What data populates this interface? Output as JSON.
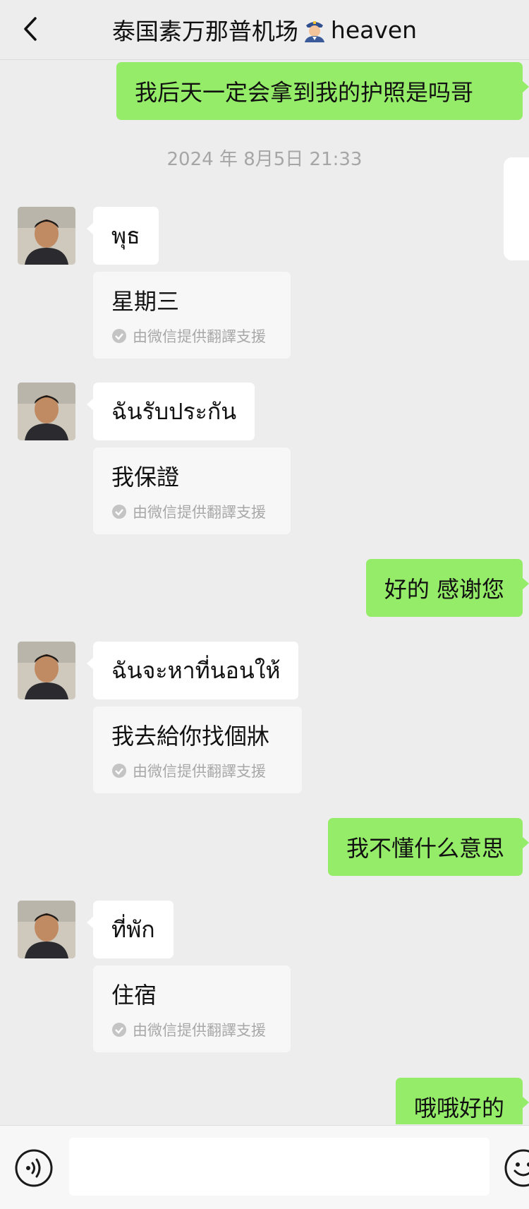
{
  "header": {
    "title": "泰国素万那普机场",
    "title_suffix": "heaven",
    "back_icon": "chevron-left-icon",
    "title_icon": "police-officer-emoji"
  },
  "timestamp": "2024 年 8月5日 21:33",
  "messages": {
    "out_1": "我后天一定会拿到我的护照是吗哥",
    "in_1": "พุธ",
    "in_1_translation": "星期三",
    "in_2": "ฉันรับประกัน",
    "in_2_translation": "我保證",
    "out_2": "好的 感谢您",
    "in_3": "ฉันจะหาที่นอนให้",
    "in_3_translation": "我去給你找個牀",
    "out_3": "我不懂什么意思",
    "in_4": "ที่พัก",
    "in_4_translation": "住宿",
    "out_4": "哦哦好的"
  },
  "translation_source": "由微信提供翻譯支援",
  "input": {
    "value": "",
    "placeholder": ""
  },
  "colors": {
    "background": "#ededed",
    "outgoing_bubble": "#95ec69",
    "incoming_bubble": "#ffffff",
    "translation_bubble": "#f7f7f7"
  }
}
